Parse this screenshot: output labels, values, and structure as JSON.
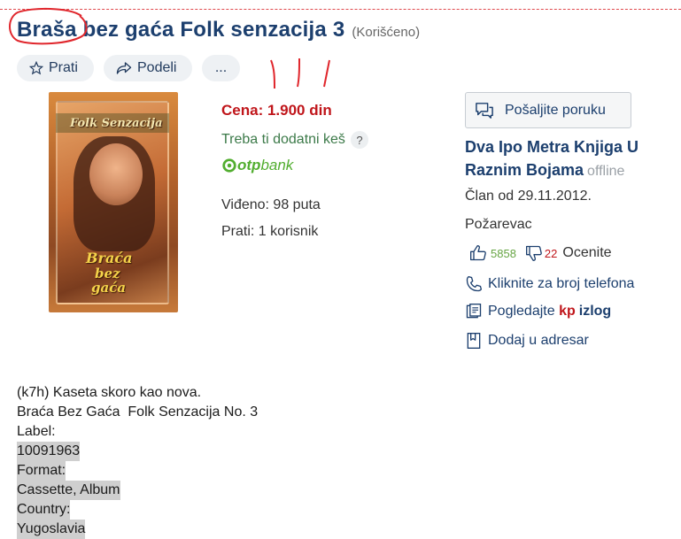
{
  "listing": {
    "title": "Braša bez gaća Folk senzacija 3",
    "condition": "(Korišćeno)",
    "price": "Cena: 1.900 din",
    "cash_text": "Treba ti dodatni keš",
    "help_glyph": "?",
    "bank_logo_bold": "otp",
    "bank_logo_thin": "bank",
    "views": "Viđeno: 98 puta",
    "followers": "Prati: 1 korisnik"
  },
  "actions": {
    "follow_label": "Prati",
    "share_label": "Podeli",
    "more_label": "..."
  },
  "cover": {
    "line1": "Folk Senzacija",
    "line2": "Braća",
    "line3": "bez",
    "line4": "gaća"
  },
  "seller": {
    "message_button": "Pošaljite poruku",
    "name": "Dva Ipo Metra Knjiga U Raznim Bojama",
    "status": "offline",
    "member_since": "Član od 29.11.2012.",
    "city": "Požarevac",
    "positive": "5858",
    "negative": "22",
    "rate_label": "Ocenite",
    "phone_link": "Kliknite za broj telefona",
    "showcase_prefix": "Pogledajte",
    "showcase_kp": "kp",
    "showcase_izlog": "izlog",
    "address_book": "Dodaj u adresar"
  },
  "description": {
    "lines": [
      "(k7h) Kaseta skoro kao nova.",
      "Braća Bez Gaća  Folk Senzacija No. 3",
      "Label:",
      "10091963",
      "Format:",
      "Cassette, Album",
      "Country:",
      "Yugoslavia"
    ]
  },
  "colors": {
    "title": "#1c3f6e",
    "price": "#c0161b",
    "cash": "#3c7a49",
    "otp_green": "#52ae30",
    "annotation_red": "#e0262c"
  }
}
